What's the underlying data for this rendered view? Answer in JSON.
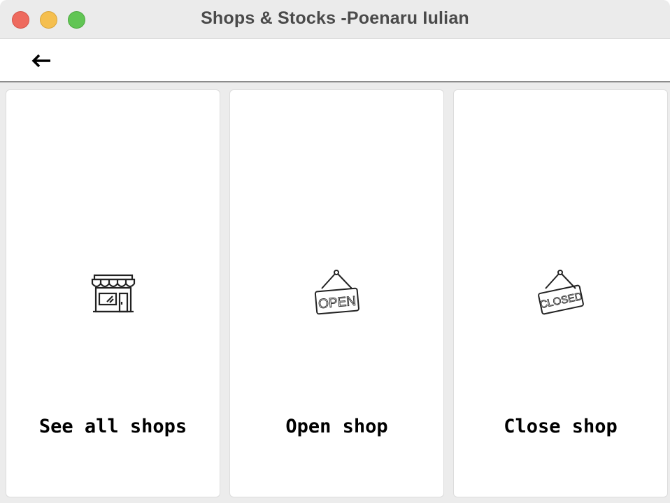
{
  "window": {
    "title": "Shops & Stocks -Poenaru Iulian"
  },
  "toolbar": {
    "back_arrow": "←"
  },
  "cards": [
    {
      "label": "See all shops",
      "icon": "storefront-icon"
    },
    {
      "label": "Open shop",
      "icon": "open-sign-icon",
      "sign_text": "OPEN"
    },
    {
      "label": "Close shop",
      "icon": "closed-sign-icon",
      "sign_text": "CLOSED"
    }
  ]
}
